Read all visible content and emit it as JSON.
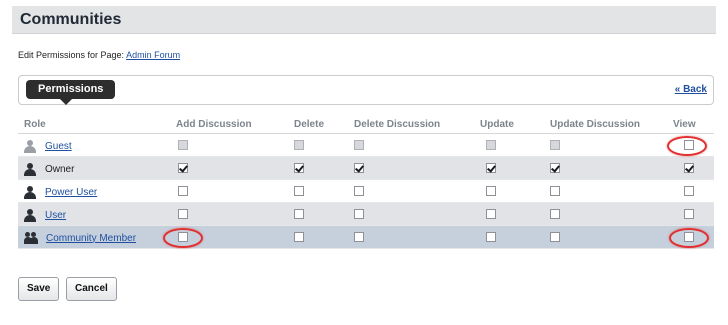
{
  "page": {
    "title": "Communities",
    "edit_prefix": "Edit Permissions for Page:",
    "page_link": "Admin Forum"
  },
  "panel": {
    "tab_label": "Permissions",
    "back_label": "« Back"
  },
  "table": {
    "columns": [
      "Role",
      "Add Discussion",
      "Delete",
      "Delete Discussion",
      "Update",
      "Update Discussion",
      "View"
    ],
    "rows": [
      {
        "role": "Guest",
        "link": true,
        "icon": "person-light-icon",
        "checks": [
          "disabled",
          "disabled",
          "disabled",
          "disabled",
          "disabled",
          "unchecked"
        ]
      },
      {
        "role": "Owner",
        "link": false,
        "icon": "person-dark-icon",
        "checks": [
          "checked",
          "checked",
          "checked",
          "checked",
          "checked",
          "checked"
        ]
      },
      {
        "role": "Power User",
        "link": true,
        "icon": "person-dark-icon",
        "checks": [
          "unchecked",
          "unchecked",
          "unchecked",
          "unchecked",
          "unchecked",
          "unchecked"
        ]
      },
      {
        "role": "User",
        "link": true,
        "icon": "person-dark-icon",
        "checks": [
          "unchecked",
          "unchecked",
          "unchecked",
          "unchecked",
          "unchecked",
          "unchecked"
        ]
      },
      {
        "role": "Community Member",
        "link": true,
        "icon": "group-icon",
        "checks": [
          "unchecked",
          "unchecked",
          "unchecked",
          "unchecked",
          "unchecked",
          "unchecked"
        ]
      }
    ]
  },
  "buttons": {
    "save": "Save",
    "cancel": "Cancel"
  },
  "colors": {
    "title_bar": "#e3e4e6",
    "tab_pill": "#2d2d2d",
    "link": "#1f4f9f",
    "highlight_oval": "#e03030",
    "selected_row": "#c6cfdc"
  }
}
